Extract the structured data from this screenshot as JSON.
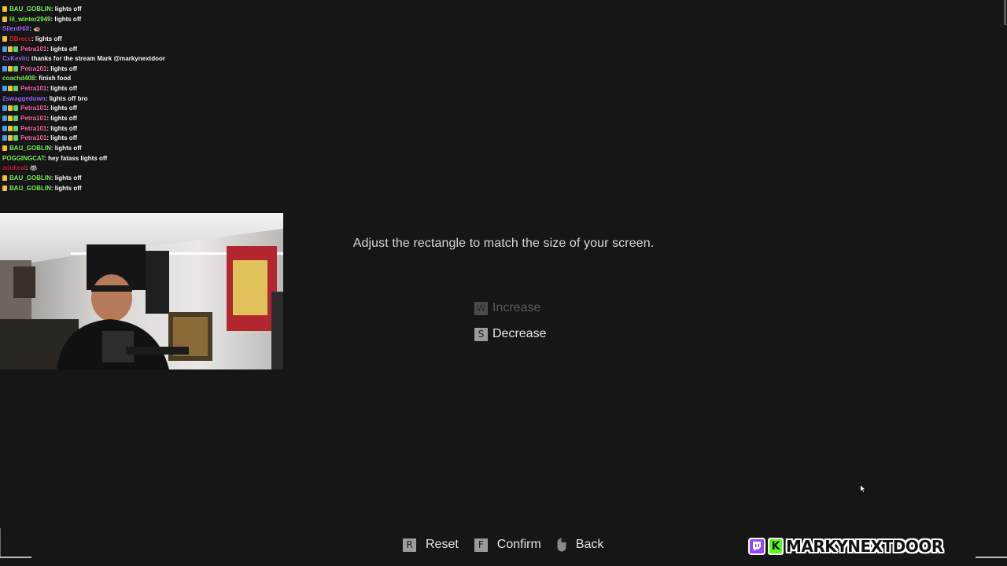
{
  "chat": [
    {
      "user": "BAU_GOBLIN",
      "color": "#7cf55a",
      "badges": [
        "#f2c230"
      ],
      "msg": "lights off"
    },
    {
      "user": "lil_winter2949",
      "color": "#7cf55a",
      "badges": [
        "#f2c230"
      ],
      "msg": "lights off"
    },
    {
      "user": "SilentHill",
      "color": "#9b6dff",
      "badges": [],
      "msg": "🦔"
    },
    {
      "user": "BBrecc",
      "color": "#d42828",
      "badges": [
        "#f2c230"
      ],
      "msg": "lights off"
    },
    {
      "user": "Petra101",
      "color": "#ff69b4",
      "badges": [
        "#3fa0ff",
        "#f2c230",
        "#5ad36a"
      ],
      "msg": "lights off"
    },
    {
      "user": "CxKevin",
      "color": "#9b6dff",
      "badges": [],
      "msg": "thanks for the stream Mark @markynextdoor"
    },
    {
      "user": "Petra101",
      "color": "#ff69b4",
      "badges": [
        "#3fa0ff",
        "#f2c230",
        "#5ad36a"
      ],
      "msg": "lights off"
    },
    {
      "user": "coachd408",
      "color": "#7cf55a",
      "badges": [],
      "msg": "finish food"
    },
    {
      "user": "Petra101",
      "color": "#ff69b4",
      "badges": [
        "#3fa0ff",
        "#f2c230",
        "#5ad36a"
      ],
      "msg": "lights off"
    },
    {
      "user": "2swaggedown",
      "color": "#9b6dff",
      "badges": [],
      "msg": "lights off bro"
    },
    {
      "user": "Petra101",
      "color": "#ff69b4",
      "badges": [
        "#3fa0ff",
        "#f2c230",
        "#5ad36a"
      ],
      "msg": "lights off"
    },
    {
      "user": "Petra101",
      "color": "#ff69b4",
      "badges": [
        "#3fa0ff",
        "#f2c230",
        "#5ad36a"
      ],
      "msg": "lights off"
    },
    {
      "user": "Petra101",
      "color": "#ff69b4",
      "badges": [
        "#3fa0ff",
        "#f2c230",
        "#5ad36a"
      ],
      "msg": "lights off"
    },
    {
      "user": "Petra101",
      "color": "#ff69b4",
      "badges": [
        "#3fa0ff",
        "#f2c230",
        "#5ad36a"
      ],
      "msg": "lights off"
    },
    {
      "user": "BAU_GOBLIN",
      "color": "#7cf55a",
      "badges": [
        "#f2c230"
      ],
      "msg": "lights off"
    },
    {
      "user": "POGGINGCAT",
      "color": "#7cf55a",
      "badges": [],
      "msg": "hey fatass lights off"
    },
    {
      "user": "adukeal",
      "color": "#c41e3a",
      "badges": [],
      "msg": "🦝"
    },
    {
      "user": "BAU_GOBLIN",
      "color": "#7cf55a",
      "badges": [
        "#f2c230"
      ],
      "msg": "lights off"
    },
    {
      "user": "BAU_GOBLIN",
      "color": "#7cf55a",
      "badges": [
        "#f2c230"
      ],
      "msg": "lights off"
    }
  ],
  "game": {
    "instruction": "Adjust the rectangle to match the size of your screen.",
    "increase": {
      "key": "W",
      "label": "Increase",
      "enabled": false
    },
    "decrease": {
      "key": "S",
      "label": "Decrease",
      "enabled": true
    },
    "bottom": {
      "reset": {
        "key": "R",
        "label": "Reset"
      },
      "confirm": {
        "key": "F",
        "label": "Confirm"
      },
      "back": {
        "icon": "mouse-icon",
        "label": "Back"
      }
    }
  },
  "overlay": {
    "channel": "MARKYNEXTDOOR",
    "kick_letter": "K",
    "icons": [
      "twitch-icon",
      "kick-icon"
    ],
    "brand_colors": {
      "twitch": "#9146ff",
      "kick": "#53fc18"
    }
  }
}
